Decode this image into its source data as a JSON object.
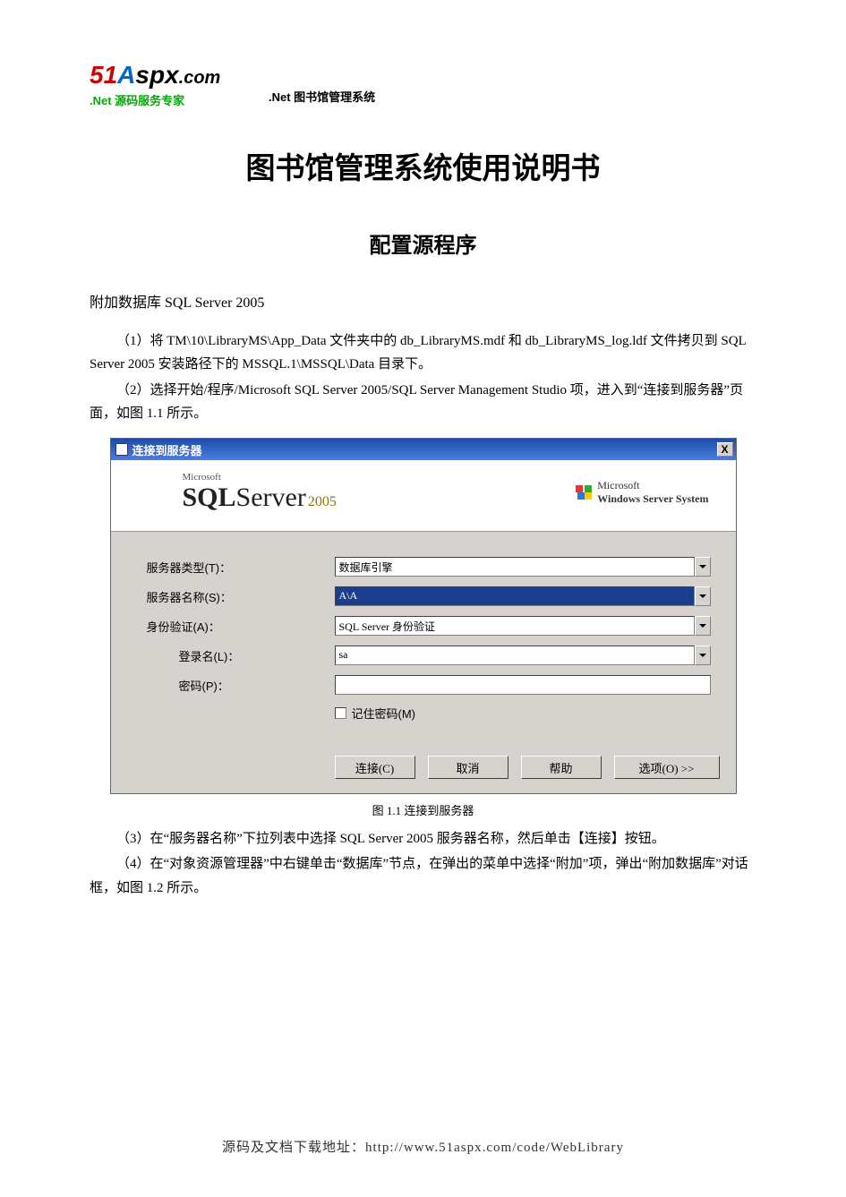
{
  "header": {
    "logo_text": "51Aspx.com",
    "logo_sub": ".Net 源码服务专家",
    "doc_label": ".Net 图书馆管理系统"
  },
  "title": "图书馆管理系统使用说明书",
  "section": "配置源程序",
  "subhead": "附加数据库 SQL Server 2005",
  "p1": "（1）将 TM\\10\\LibraryMS\\App_Data 文件夹中的 db_LibraryMS.mdf 和 db_LibraryMS_log.ldf 文件拷贝到 SQL Server 2005 安装路径下的 MSSQL.1\\MSSQL\\Data 目录下。",
  "p2": "（2）选择开始/程序/Microsoft SQL Server 2005/SQL Server Management Studio 项，进入到“连接到服务器”页面，如图 1.1 所示。",
  "dialog": {
    "title": "连接到服务器",
    "close": "X",
    "banner_ms": "Microsoft",
    "banner_sql_a": "SQL",
    "banner_sql_b": "Server",
    "banner_year": "2005",
    "banner_wss_a": "Microsoft",
    "banner_wss_b": "Windows Server System",
    "labels": {
      "server_type": "服务器类型(T)：",
      "server_name": "服务器名称(S)：",
      "auth": "身份验证(A)：",
      "login": "登录名(L)：",
      "password": "密码(P)："
    },
    "values": {
      "server_type": "数据库引擎",
      "server_name": "A\\A",
      "auth": "SQL Server 身份验证",
      "login": "sa",
      "password": ""
    },
    "remember": "记住密码(M)",
    "buttons": {
      "connect": "连接(C)",
      "cancel": "取消",
      "help": "帮助",
      "options": "选项(O) >>"
    }
  },
  "fig_caption": "图 1.1  连接到服务器",
  "p3": "（3）在“服务器名称”下拉列表中选择 SQL Server 2005 服务器名称，然后单击【连接】按钮。",
  "p4": "（4）在“对象资源管理器”中右键单击“数据库”节点，在弹出的菜单中选择“附加”项，弹出“附加数据库”对话框，如图 1.2 所示。",
  "footer": "源码及文档下载地址：http://www.51aspx.com/code/WebLibrary"
}
